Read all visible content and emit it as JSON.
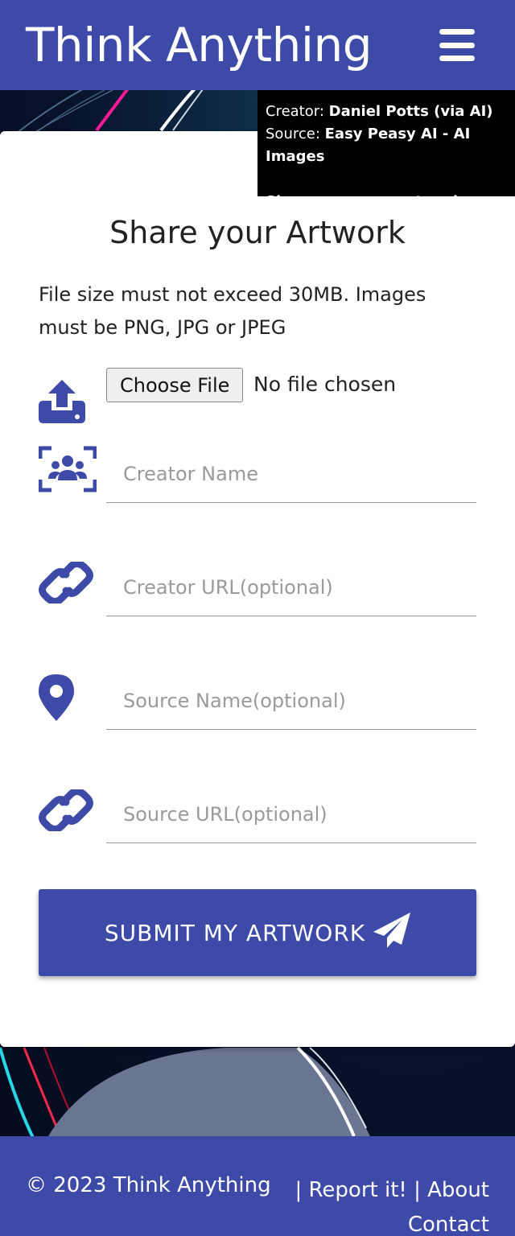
{
  "header": {
    "brand": "Think Anything",
    "menu_icon": "hamburger-menu-icon",
    "color": "#3d4aa8"
  },
  "credit": {
    "creator_label": "Creator:",
    "creator_value": "Daniel Potts (via AI)",
    "source_label": "Source:",
    "source_value": "Easy Peasy AI - AI Images",
    "share_link": "Share your own artwork"
  },
  "form": {
    "title": "Share your Artwork",
    "note": "File size must not exceed 30MB. Images must be PNG, JPG or JPEG",
    "file_button": "Choose File",
    "file_status": "No file chosen",
    "creator_name_placeholder": "Creator Name",
    "creator_url_placeholder": "Creator URL(optional)",
    "source_name_placeholder": "Source Name(optional)",
    "source_url_placeholder": "Source URL(optional)",
    "submit_label": "SUBMIT MY ARTWORK",
    "icons": [
      "upload-icon",
      "group-icon",
      "link-icon",
      "location-pin-icon",
      "link-icon",
      "paper-plane-icon"
    ]
  },
  "footer": {
    "copyright": "© 2023 Think Anything",
    "separator": "|",
    "report": "Report it!",
    "about": "About",
    "contact": "Contact"
  }
}
